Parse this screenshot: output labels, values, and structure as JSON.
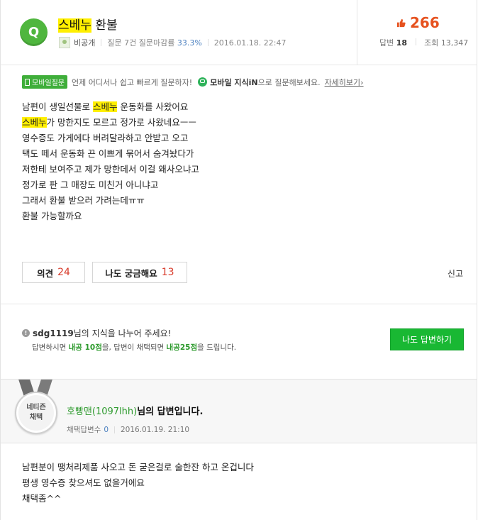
{
  "question": {
    "badge": "Q",
    "title_highlight": "스베누",
    "title_rest": " 환불",
    "author": "비공개",
    "stats": "질문 7건 질문마감률",
    "close_rate": "33.3%",
    "date": "2016.01.18. 22:47",
    "likes": "266",
    "answers_label": "답변",
    "answers_count": "18",
    "views_label": "조회",
    "views_count": "13,347"
  },
  "mobile_bar": {
    "tag": "모바일질문",
    "text": "언제 어디서나 쉽고 빠르게 질문하자!",
    "kin_bold": "모바일 지식iN",
    "kin_text": "으로 질문해보세요.",
    "link": "자세히보기›"
  },
  "body": {
    "line1_a": "남편이 생일선물로 ",
    "line1_hl": "스베누",
    "line1_b": " 운동화를 사왔어요",
    "line2_hl": "스베누",
    "line2_b": "가 망한지도 모르고 정가로 사왔네요ㅡㅡ",
    "line3": "영수증도 가게에다 버려달라하고 안받고 오고",
    "line4": "택도 떼서 운동화 끈 이쁘게 묶어서 숨겨놨다가",
    "line5": "저한테 보여주고 제가 망한데서 이걸 왜사오냐고",
    "line6": "정가로 판 그 매장도 미친거 아니냐고",
    "line7": "그래서 환불 받으러 가려는데ㅠㅠ",
    "line8": "환불 가능할까요"
  },
  "actions": {
    "opinion_label": "의견",
    "opinion_count": "24",
    "curious_label": "나도 궁금해요",
    "curious_count": "13",
    "report": "신고"
  },
  "ask": {
    "user": "sdg1119",
    "text": "님의 지식을 나누어 주세요!",
    "sub_a": "답변하시면 ",
    "sub_pts1": "내공 10점",
    "sub_b": "을, 답변이 채택되면 ",
    "sub_pts2": "내공25점",
    "sub_c": "을 드립니다.",
    "button": "나도 답변하기"
  },
  "answer": {
    "medal_line1": "네티즌",
    "medal_line2": "채택",
    "user": "호빵맨(1097lhh)",
    "suffix": "님의 답변입니다.",
    "adopt_label": "채택답변수",
    "adopt_count": "0",
    "date": "2016.01.19. 21:10",
    "line1": "남편분이 땡처리제품 사오고 돈 굳은걸로 술한잔 하고 온겁니다",
    "line2": "평생 영수증 찾으셔도 없을거에요",
    "line3": "채택좀^^"
  },
  "colors": {
    "green": "#19b833",
    "highlight": "#ffef00",
    "like_orange": "#e6521f",
    "count_red": "#d83b2b"
  }
}
